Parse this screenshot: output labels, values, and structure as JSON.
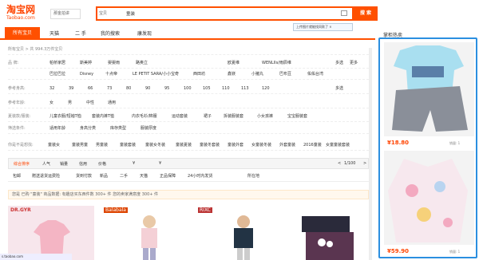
{
  "header": {
    "logo": "淘宝网",
    "logo_sub": "Taobao.com",
    "region": "那金拍讲",
    "search_scope": "宝贝",
    "search_value": "童装",
    "search_button": "搜 索",
    "tooltip": "上传图片就能找同款了 ×"
  },
  "nav": {
    "active": "所有宝贝",
    "items": [
      "天猫",
      "二 手",
      "我的搜索",
      "康发现"
    ]
  },
  "side": {
    "title": "掌柜热卖",
    "cards": [
      {
        "price": "¥18.80",
        "sold": "销量: 1"
      },
      {
        "price": "¥59.90",
        "sold": "销量: 1"
      }
    ]
  },
  "filters": {
    "summary": "所有宝贝 > 共 994.3万件宝贝",
    "rows": [
      {
        "label": "品 牌:",
        "values": [
          "帕桥家居",
          "斯美婷",
          "婴婴雨",
          "路奥立",
          "欧夏维",
          "WENLIIs/雨辰维",
          "更多",
          "多选"
        ]
      },
      {
        "label": "",
        "values": [
          "巴拉巴拉",
          "Disney",
          "十点帝",
          "LE PETIT SARA/小小宝奇",
          "西田坊",
          "鑫镁",
          "小猪丸",
          "巴布豆",
          "佑佑台湾"
        ]
      },
      {
        "label": "参考身高:",
        "values": [
          "32",
          "39",
          "66",
          "73",
          "80",
          "90",
          "95",
          "100",
          "105",
          "110",
          "113",
          "120",
          "多选"
        ]
      },
      {
        "label": "参考年龄:",
        "values": [
          "女",
          "男",
          "中性",
          "通用"
        ]
      },
      {
        "label": "夏装款/服装:",
        "values": [
          "儿童衣服/短袖T恤",
          "套装内裤T恤",
          "内衣毛衫/棉服",
          "运动套装",
          "裙子",
          "拆装服装套",
          "小女孩裤",
          "宝宝服装套",
          "婴儿外套"
        ]
      },
      {
        "label": "筛选条件:",
        "values": [
          "适用年龄",
          "身高分类",
          "库存类型",
          "服装厚度"
        ]
      }
    ],
    "related_label": "你是不是想找:",
    "related": [
      "童装女",
      "童装男童",
      "男童装",
      "童装套装",
      "童装女冬装",
      "童装夏装",
      "童装冬套装",
      "童装外套",
      "女童装冬装",
      "外套童装",
      "2016童装",
      "女童童装套装"
    ]
  },
  "sort": {
    "items": [
      "综合排序",
      "人气",
      "销量",
      "信用",
      "价格",
      "¥",
      "¥"
    ],
    "page": "1/100",
    "prev": "<",
    "next": ">"
  },
  "checks": {
    "items": [
      "包邮",
      "赠送退货运费险",
      "货到付款",
      "新品",
      "二手",
      "天猫",
      "正品保障",
      "24小时内发货"
    ],
    "location": "所在地"
  },
  "banner": {
    "text": "您是 已购 \"童装\" 商品数据: 有趣店买东西件数 300+ 件 您的卖家满意度 300+ 件"
  },
  "products": [
    {
      "brand": "DR.GYR"
    },
    {
      "brand": "Balabala"
    },
    {
      "brand": "RIXC"
    },
    {
      "brand": ""
    }
  ],
  "statusbar": "s.taobao.com",
  "colors": {
    "accent": "#ff5000",
    "price": "#ff4400",
    "highlight": "#2b8fe0"
  }
}
